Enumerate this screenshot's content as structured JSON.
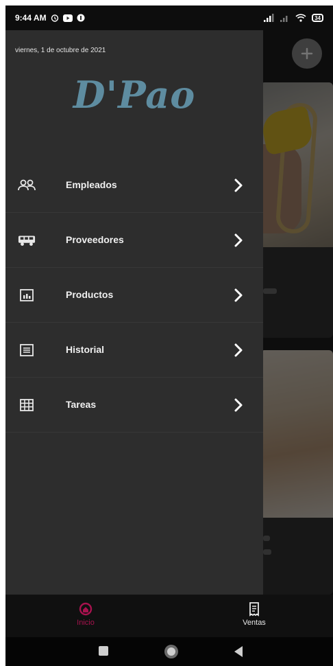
{
  "status_bar": {
    "time": "9:44 AM",
    "battery": "34"
  },
  "drawer": {
    "date": "viernes, 1 de octubre de 2021",
    "brand": "D'Pao",
    "items": [
      {
        "label": "Empleados",
        "icon": "people-icon"
      },
      {
        "label": "Proveedores",
        "icon": "truck-icon"
      },
      {
        "label": "Productos",
        "icon": "chart-box-icon"
      },
      {
        "label": "Historial",
        "icon": "document-list-icon"
      },
      {
        "label": "Tareas",
        "icon": "grid-icon"
      }
    ]
  },
  "bottom_nav": {
    "items": [
      {
        "label": "Inicio",
        "icon": "home-icon",
        "active": true
      },
      {
        "label": "Ventas",
        "icon": "receipt-icon",
        "active": false
      }
    ]
  },
  "colors": {
    "drawer_bg": "#2d2d2d",
    "brand": "#5e8ca0",
    "active_nav": "#a8124e",
    "text": "#f0f0f0"
  }
}
